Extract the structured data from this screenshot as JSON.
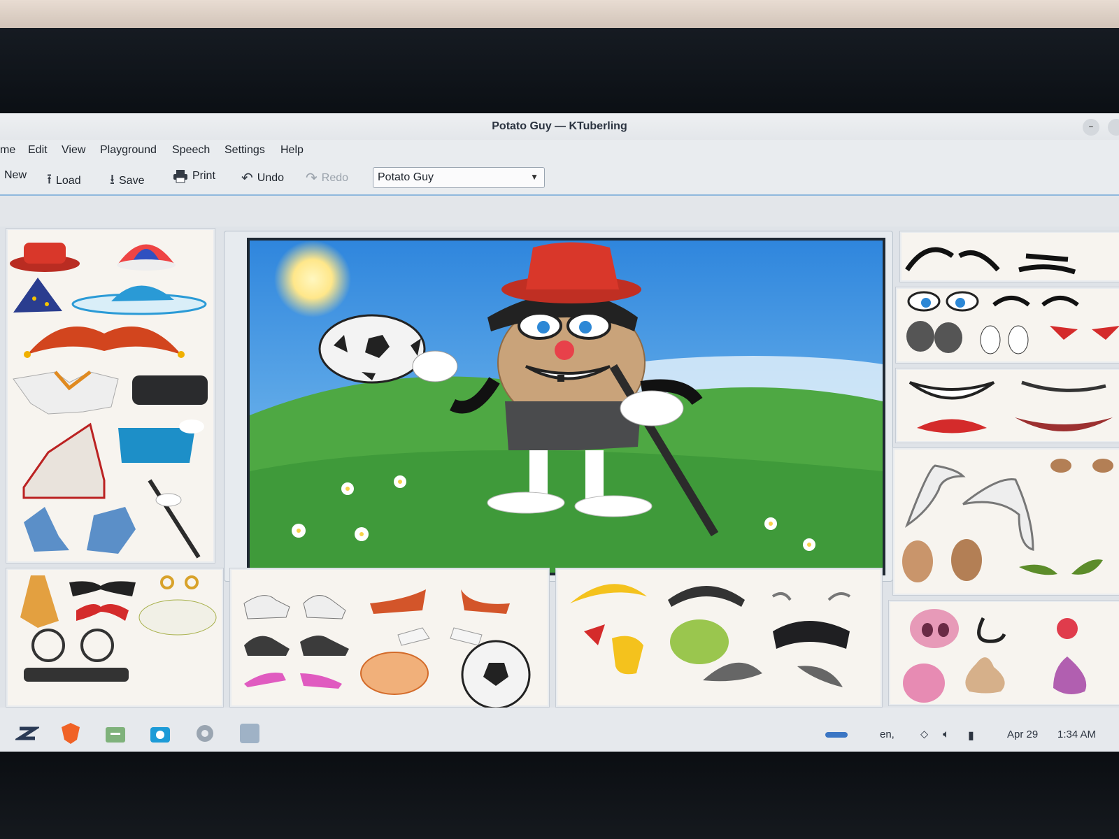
{
  "window": {
    "title": "Potato Guy — KTuberling"
  },
  "menu": [
    "me",
    "Edit",
    "View",
    "Playground",
    "Speech",
    "Settings",
    "Help"
  ],
  "toolbar": {
    "new": "New",
    "load": "Load",
    "save": "Save",
    "print": "Print",
    "undo": "Undo",
    "redo": "Redo",
    "playground_select": "Potato Guy"
  },
  "taskbar": {
    "keyboard_layout": "en,",
    "date": "Apr 29",
    "time": "1:34 AM"
  },
  "colors": {
    "accent": "#8fb8dd",
    "sky": "#3a8fe0",
    "grass": "#4ea843",
    "hat_red": "#d9372a",
    "potato": "#c9a37a"
  },
  "icons": [
    "load-icon",
    "save-icon",
    "print-icon",
    "undo-icon",
    "redo-icon",
    "app-launcher-icon",
    "browser-icon",
    "file-manager-icon",
    "screenshot-icon",
    "settings-icon",
    "ktuberling-icon",
    "wifi-icon",
    "volume-icon",
    "battery-icon"
  ]
}
